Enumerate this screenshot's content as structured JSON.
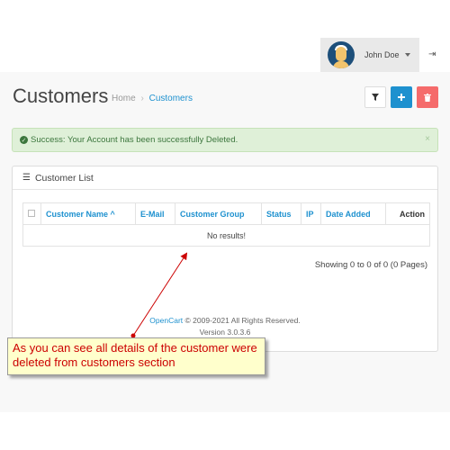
{
  "header": {
    "user_name": "John Doe",
    "icons": {
      "caret": "chevron-down-icon",
      "logout": "sign-out-icon"
    }
  },
  "page": {
    "title": "Customers",
    "breadcrumb": {
      "home": "Home",
      "sep": "›",
      "current": "Customers"
    },
    "toolbar": {
      "filter_icon": "filter-icon",
      "add_icon": "plus-icon",
      "delete_icon": "trash-icon"
    }
  },
  "alert": {
    "text": "Success: Your Account has been successfully Deleted.",
    "close": "×"
  },
  "panel": {
    "title": "Customer List",
    "columns": [
      "Customer Name ^",
      "E-Mail",
      "Customer Group",
      "Status",
      "IP",
      "Date Added",
      "Action"
    ],
    "empty_text": "No results!",
    "pagination": "Showing 0 to 0 of 0 (0 Pages)"
  },
  "footer": {
    "brand": "OpenCart",
    "copyright": "© 2009-2021 All Rights Reserved.",
    "version": "Version 3.0.3.6"
  },
  "callout": {
    "text": "As you can see all details of the customer were deleted from customers section"
  },
  "colors": {
    "accent": "#1e91cf",
    "danger": "#f56b6b",
    "success_bg": "#dff0d8",
    "success_text": "#3c763d",
    "callout_text": "#cc0000",
    "callout_bg": "#ffffcc"
  }
}
